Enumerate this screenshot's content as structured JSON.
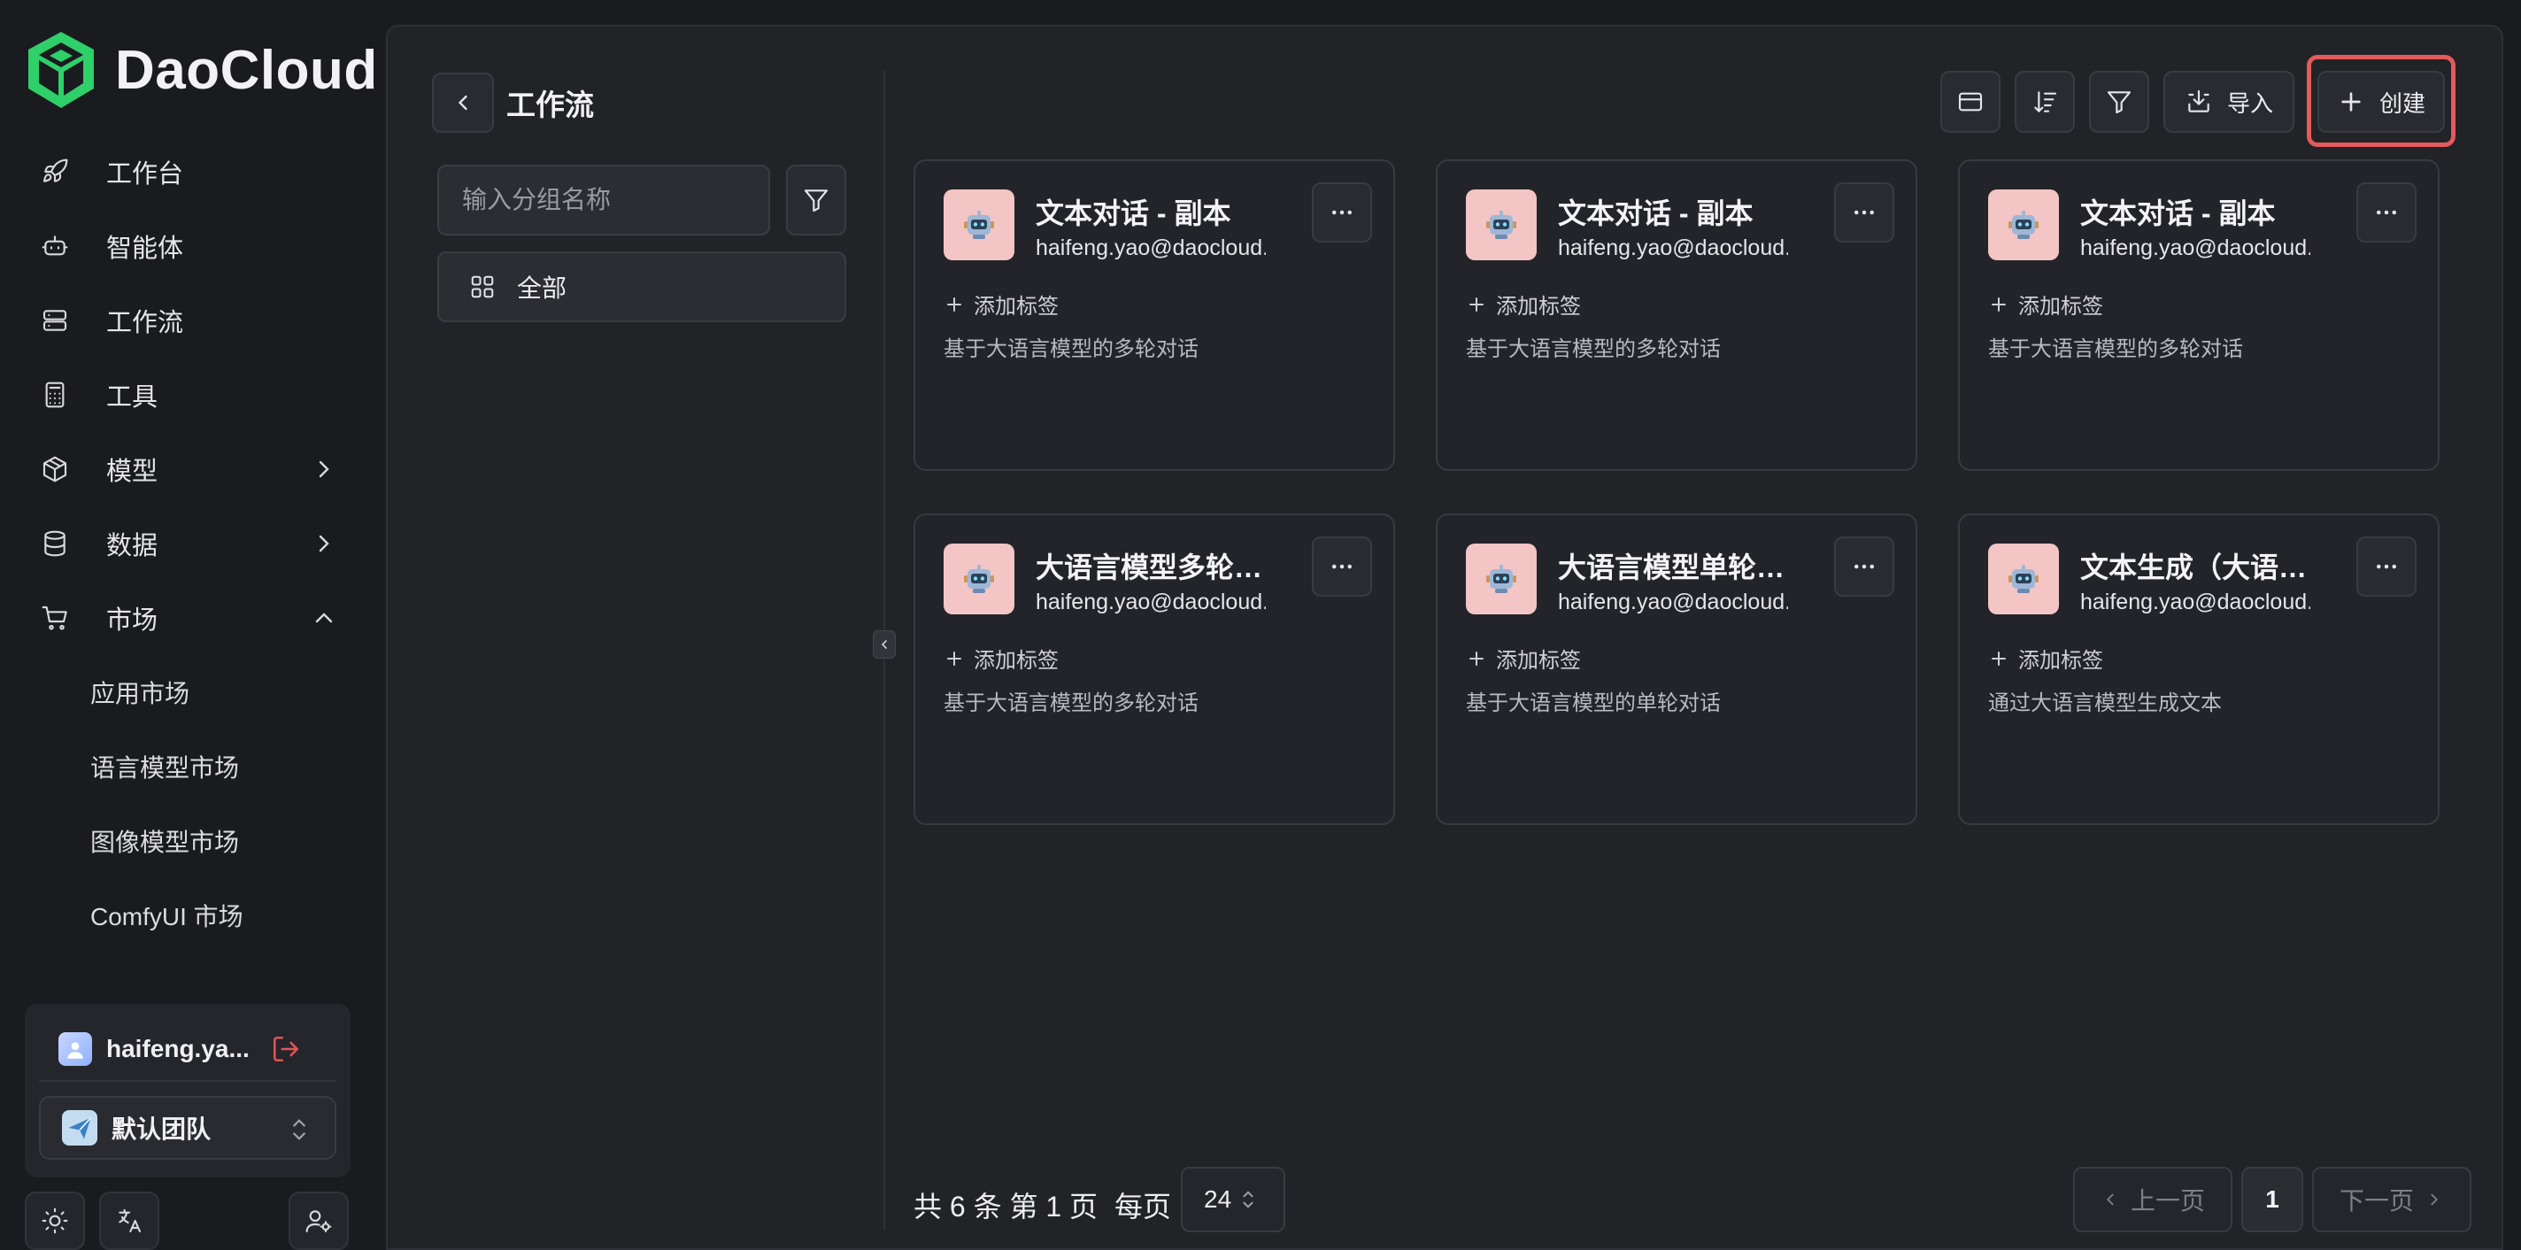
{
  "brand": {
    "name": "DaoCloud"
  },
  "nav": {
    "items": [
      {
        "label": "工作台",
        "icon": "rocket-icon"
      },
      {
        "label": "智能体",
        "icon": "robot-icon"
      },
      {
        "label": "工作流",
        "icon": "server-icon"
      },
      {
        "label": "工具",
        "icon": "calculator-icon"
      },
      {
        "label": "模型",
        "icon": "cube-icon"
      },
      {
        "label": "数据",
        "icon": "database-icon"
      },
      {
        "label": "市场",
        "icon": "cart-icon"
      }
    ],
    "market_sub": [
      "应用市场",
      "语言模型市场",
      "图像模型市场",
      "ComfyUI 市场"
    ]
  },
  "user": {
    "name": "haifeng.ya...",
    "team": "默认团队"
  },
  "header": {
    "title": "工作流"
  },
  "groups": {
    "search_placeholder": "输入分组名称",
    "all_label": "全部"
  },
  "toolbar": {
    "import_label": "导入",
    "create_label": "创建"
  },
  "cards": [
    {
      "title": "文本对话 - 副本",
      "owner": "haifeng.yao@daocloud.io",
      "tag_label": "添加标签",
      "desc": "基于大语言模型的多轮对话"
    },
    {
      "title": "文本对话 - 副本",
      "owner": "haifeng.yao@daocloud.io",
      "tag_label": "添加标签",
      "desc": "基于大语言模型的多轮对话"
    },
    {
      "title": "文本对话 - 副本",
      "owner": "haifeng.yao@daocloud.io",
      "tag_label": "添加标签",
      "desc": "基于大语言模型的多轮对话"
    },
    {
      "title": "大语言模型多轮对话",
      "owner": "haifeng.yao@daocloud.io",
      "tag_label": "添加标签",
      "desc": "基于大语言模型的多轮对话"
    },
    {
      "title": "大语言模型单轮对话",
      "owner": "haifeng.yao@daocloud.io",
      "tag_label": "添加标签",
      "desc": "基于大语言模型的单轮对话"
    },
    {
      "title": "文本生成（大语言模型）",
      "owner": "haifeng.yao@daocloud.io",
      "tag_label": "添加标签",
      "desc": "通过大语言模型生成文本"
    }
  ],
  "pagination": {
    "total_text": "共 6 条 第 1 页",
    "per_page_label": "每页",
    "page_size": "24",
    "prev_label": "上一页",
    "current_page": "1",
    "next_label": "下一页"
  },
  "colors": {
    "accent": "#e55a5a",
    "brand_green": "#2fcf6a",
    "bg": "#1a1b1f",
    "panel": "#222327"
  }
}
